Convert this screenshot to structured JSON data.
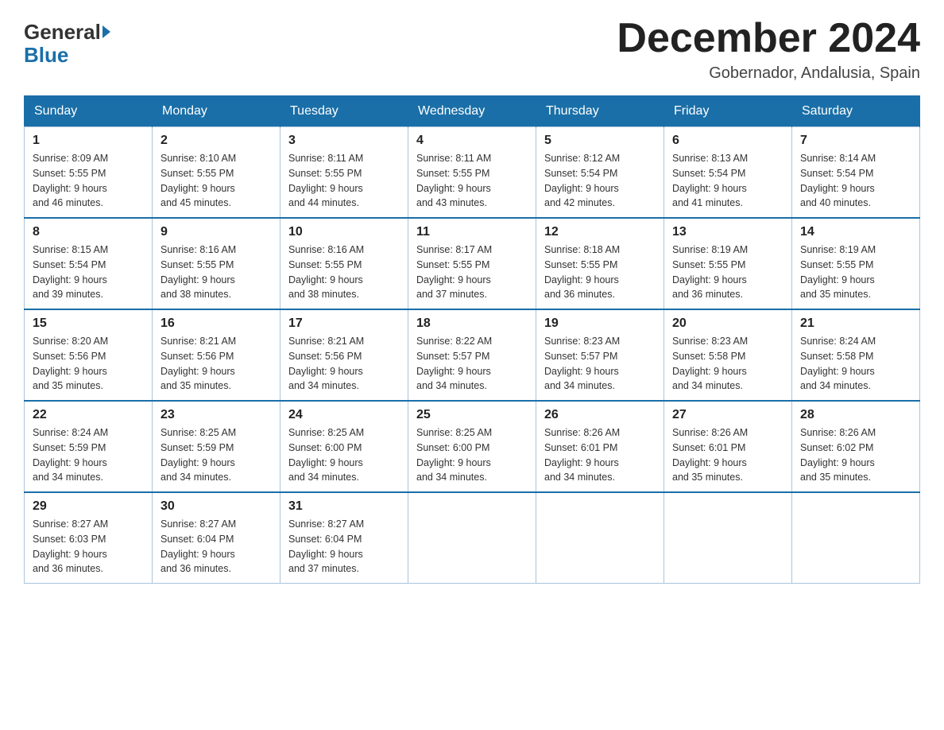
{
  "logo": {
    "general": "General",
    "blue": "Blue"
  },
  "title": {
    "month_year": "December 2024",
    "location": "Gobernador, Andalusia, Spain"
  },
  "headers": [
    "Sunday",
    "Monday",
    "Tuesday",
    "Wednesday",
    "Thursday",
    "Friday",
    "Saturday"
  ],
  "weeks": [
    [
      {
        "day": "1",
        "sunrise": "8:09 AM",
        "sunset": "5:55 PM",
        "daylight": "9 hours and 46 minutes."
      },
      {
        "day": "2",
        "sunrise": "8:10 AM",
        "sunset": "5:55 PM",
        "daylight": "9 hours and 45 minutes."
      },
      {
        "day": "3",
        "sunrise": "8:11 AM",
        "sunset": "5:55 PM",
        "daylight": "9 hours and 44 minutes."
      },
      {
        "day": "4",
        "sunrise": "8:11 AM",
        "sunset": "5:55 PM",
        "daylight": "9 hours and 43 minutes."
      },
      {
        "day": "5",
        "sunrise": "8:12 AM",
        "sunset": "5:54 PM",
        "daylight": "9 hours and 42 minutes."
      },
      {
        "day": "6",
        "sunrise": "8:13 AM",
        "sunset": "5:54 PM",
        "daylight": "9 hours and 41 minutes."
      },
      {
        "day": "7",
        "sunrise": "8:14 AM",
        "sunset": "5:54 PM",
        "daylight": "9 hours and 40 minutes."
      }
    ],
    [
      {
        "day": "8",
        "sunrise": "8:15 AM",
        "sunset": "5:54 PM",
        "daylight": "9 hours and 39 minutes."
      },
      {
        "day": "9",
        "sunrise": "8:16 AM",
        "sunset": "5:55 PM",
        "daylight": "9 hours and 38 minutes."
      },
      {
        "day": "10",
        "sunrise": "8:16 AM",
        "sunset": "5:55 PM",
        "daylight": "9 hours and 38 minutes."
      },
      {
        "day": "11",
        "sunrise": "8:17 AM",
        "sunset": "5:55 PM",
        "daylight": "9 hours and 37 minutes."
      },
      {
        "day": "12",
        "sunrise": "8:18 AM",
        "sunset": "5:55 PM",
        "daylight": "9 hours and 36 minutes."
      },
      {
        "day": "13",
        "sunrise": "8:19 AM",
        "sunset": "5:55 PM",
        "daylight": "9 hours and 36 minutes."
      },
      {
        "day": "14",
        "sunrise": "8:19 AM",
        "sunset": "5:55 PM",
        "daylight": "9 hours and 35 minutes."
      }
    ],
    [
      {
        "day": "15",
        "sunrise": "8:20 AM",
        "sunset": "5:56 PM",
        "daylight": "9 hours and 35 minutes."
      },
      {
        "day": "16",
        "sunrise": "8:21 AM",
        "sunset": "5:56 PM",
        "daylight": "9 hours and 35 minutes."
      },
      {
        "day": "17",
        "sunrise": "8:21 AM",
        "sunset": "5:56 PM",
        "daylight": "9 hours and 34 minutes."
      },
      {
        "day": "18",
        "sunrise": "8:22 AM",
        "sunset": "5:57 PM",
        "daylight": "9 hours and 34 minutes."
      },
      {
        "day": "19",
        "sunrise": "8:23 AM",
        "sunset": "5:57 PM",
        "daylight": "9 hours and 34 minutes."
      },
      {
        "day": "20",
        "sunrise": "8:23 AM",
        "sunset": "5:58 PM",
        "daylight": "9 hours and 34 minutes."
      },
      {
        "day": "21",
        "sunrise": "8:24 AM",
        "sunset": "5:58 PM",
        "daylight": "9 hours and 34 minutes."
      }
    ],
    [
      {
        "day": "22",
        "sunrise": "8:24 AM",
        "sunset": "5:59 PM",
        "daylight": "9 hours and 34 minutes."
      },
      {
        "day": "23",
        "sunrise": "8:25 AM",
        "sunset": "5:59 PM",
        "daylight": "9 hours and 34 minutes."
      },
      {
        "day": "24",
        "sunrise": "8:25 AM",
        "sunset": "6:00 PM",
        "daylight": "9 hours and 34 minutes."
      },
      {
        "day": "25",
        "sunrise": "8:25 AM",
        "sunset": "6:00 PM",
        "daylight": "9 hours and 34 minutes."
      },
      {
        "day": "26",
        "sunrise": "8:26 AM",
        "sunset": "6:01 PM",
        "daylight": "9 hours and 34 minutes."
      },
      {
        "day": "27",
        "sunrise": "8:26 AM",
        "sunset": "6:01 PM",
        "daylight": "9 hours and 35 minutes."
      },
      {
        "day": "28",
        "sunrise": "8:26 AM",
        "sunset": "6:02 PM",
        "daylight": "9 hours and 35 minutes."
      }
    ],
    [
      {
        "day": "29",
        "sunrise": "8:27 AM",
        "sunset": "6:03 PM",
        "daylight": "9 hours and 36 minutes."
      },
      {
        "day": "30",
        "sunrise": "8:27 AM",
        "sunset": "6:04 PM",
        "daylight": "9 hours and 36 minutes."
      },
      {
        "day": "31",
        "sunrise": "8:27 AM",
        "sunset": "6:04 PM",
        "daylight": "9 hours and 37 minutes."
      },
      null,
      null,
      null,
      null
    ]
  ],
  "labels": {
    "sunrise": "Sunrise:",
    "sunset": "Sunset:",
    "daylight": "Daylight:"
  }
}
